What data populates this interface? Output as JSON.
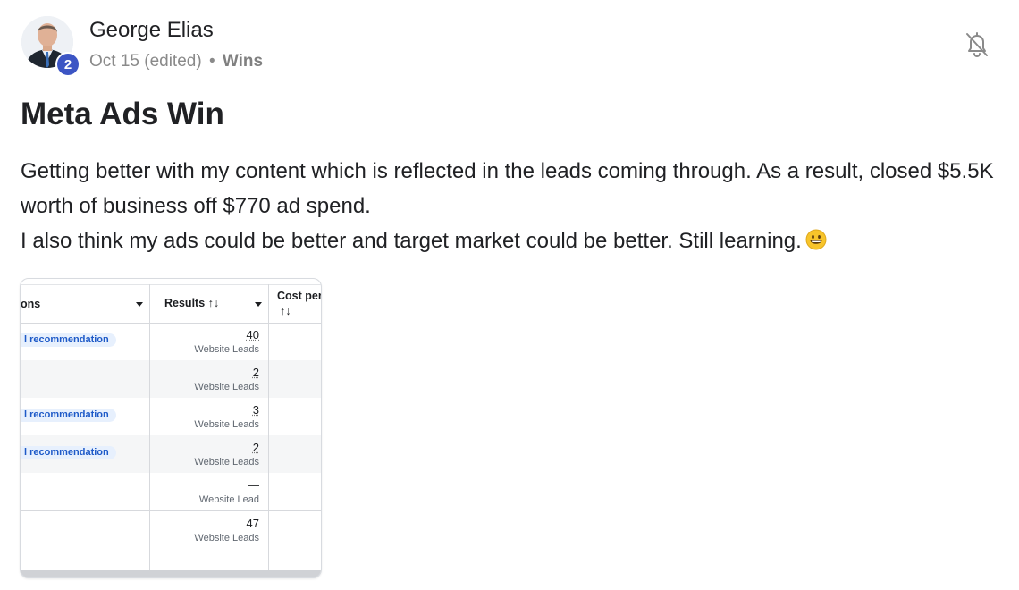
{
  "post": {
    "author": "George Elias",
    "level": "2",
    "date": "Oct 15 (edited)",
    "separator": "•",
    "category": "Wins",
    "title": "Meta Ads Win",
    "body_line1": "Getting better with my content which is reflected in the leads coming through. As a result, closed $5.5K worth of business off $770 ad spend.",
    "body_line2": "I also think my ads could be better and target market could be better. Still learning.",
    "emoji": "grinning-face-emoji",
    "bell_icon": "bell-off-icon"
  },
  "screenshot": {
    "col1_header": "ons",
    "col2_header": "Results ↑↓",
    "col3_header_line1": "Cost per",
    "col3_header_line2": "↑↓",
    "rows": [
      {
        "tag": "l recommendation",
        "value": "40",
        "sub": "Website Leads"
      },
      {
        "tag": "",
        "value": "2",
        "sub": "Website Leads"
      },
      {
        "tag": "l recommendation",
        "value": "3",
        "sub": "Website Leads"
      },
      {
        "tag": "l recommendation",
        "value": "2",
        "sub": "Website Leads"
      },
      {
        "tag": "",
        "value": "—",
        "sub": "Website Lead"
      },
      {
        "tag": "",
        "value": "47",
        "sub": "Website Leads"
      }
    ]
  },
  "colors": {
    "badge": "#3c55c4",
    "tag_bg": "#e7f0fd",
    "tag_text": "#1e5ac8",
    "alt_row": "#f5f6f7"
  }
}
